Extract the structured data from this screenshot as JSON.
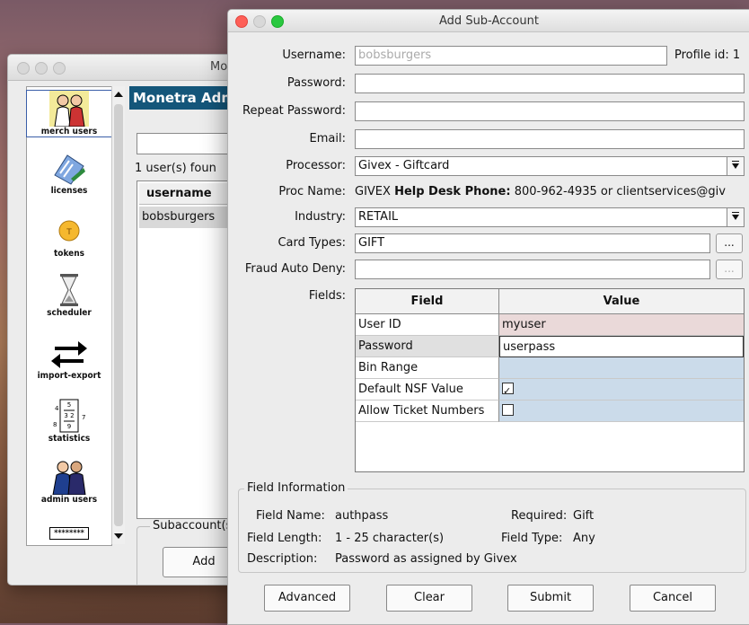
{
  "back_window": {
    "title": "Mo",
    "banner": "Monetra Adm",
    "found_text": "1 user(s) foun",
    "list_header": "username",
    "list_row": "bobsburgers",
    "sub_group_label": "Subaccount(s",
    "add_button": "Add",
    "tools": [
      {
        "label": "merch users",
        "icon": "merchant-users-icon"
      },
      {
        "label": "licenses",
        "icon": "licenses-icon"
      },
      {
        "label": "tokens",
        "icon": "tokens-icon"
      },
      {
        "label": "scheduler",
        "icon": "hourglass-icon"
      },
      {
        "label": "import-export",
        "icon": "arrows-icon"
      },
      {
        "label": "statistics",
        "icon": "statistics-icon"
      },
      {
        "label": "admin users",
        "icon": "admin-users-icon"
      },
      {
        "label": "********",
        "icon": "password-icon"
      }
    ]
  },
  "dialog": {
    "title": "Add Sub-Account",
    "labels": {
      "username": "Username:",
      "password": "Password:",
      "repeat_password": "Repeat Password:",
      "email": "Email:",
      "processor": "Processor:",
      "proc_name": "Proc Name:",
      "industry": "Industry:",
      "card_types": "Card Types:",
      "fraud_auto_deny": "Fraud Auto Deny:",
      "fields": "Fields:"
    },
    "username_value": "bobsburgers",
    "profile_id": "Profile id: 1",
    "password_value": "",
    "repeat_password_value": "",
    "email_value": "",
    "processor_value": "Givex - Giftcard",
    "proc_name_value": "GIVEX",
    "help_desk_label": "Help Desk Phone:",
    "help_desk_value": "800-962-4935 or clientservices@giv",
    "industry_value": "RETAIL",
    "card_types_value": "GIFT",
    "fraud_auto_deny_value": "",
    "ellipsis": "...",
    "grid": {
      "headers": [
        "Field",
        "Value"
      ],
      "rows": [
        {
          "field": "User ID",
          "value": "myuser"
        },
        {
          "field": "Password",
          "value": "userpass"
        },
        {
          "field": "Bin Range",
          "value": ""
        },
        {
          "field": "Default NSF Value",
          "value": "",
          "checked": true
        },
        {
          "field": "Allow Ticket Numbers",
          "value": "",
          "checked": false
        }
      ]
    },
    "field_info": {
      "title": "Field Information",
      "name_label": "Field Name:",
      "name_value": "authpass",
      "required_label": "Required:",
      "required_value": "Gift",
      "length_label": "Field Length:",
      "length_value": "1 - 25 character(s)",
      "type_label": "Field Type:",
      "type_value": "Any",
      "desc_label": "Description:",
      "desc_value": "Password as assigned by Givex"
    },
    "buttons": {
      "advanced": "Advanced",
      "clear": "Clear",
      "submit": "Submit",
      "cancel": "Cancel"
    }
  }
}
